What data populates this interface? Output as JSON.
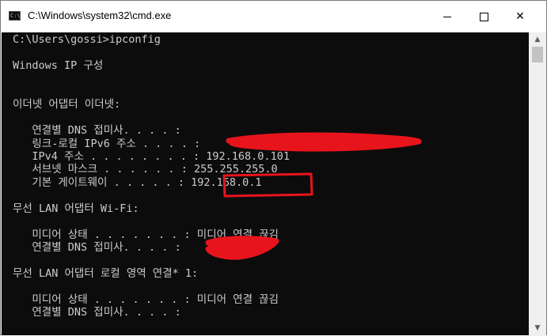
{
  "window": {
    "title": "C:\\Windows\\system32\\cmd.exe",
    "icon_name": "cmd-icon",
    "controls": {
      "minimize": "minimize-icon",
      "maximize": "maximize-icon",
      "close": "✕"
    }
  },
  "console": {
    "lines": [
      "C:\\Users\\gossi>ipconfig",
      "Windows IP 구성",
      "이더넷 어댑터 이더넷:",
      "   연결별 DNS 접미사. . . . :",
      "   링크-로컬 IPv6 주소 . . . . :",
      "   IPv4 주소 . . . . . . . . : 192.168.0.101",
      "   서브넷 마스크 . . . . . . : 255.255.255.0",
      "   기본 게이트웨이 . . . . . : 192.168.0.1",
      "무선 LAN 어댑터 Wi-Fi:",
      "   미디어 상태 . . . . . . . : 미디어 연결 끊김",
      "   연결별 DNS 접미사. . . . :",
      "무선 LAN 어댑터 로컬 영역 연결* 1:",
      "   미디어 상태 . . . . . . . : 미디어 연결 끊김",
      "   연결별 DNS 접미사. . . . :"
    ]
  },
  "colors": {
    "console_bg": "#0c0c0c",
    "console_fg": "#cccccc",
    "annotation_red": "#e8141c"
  }
}
